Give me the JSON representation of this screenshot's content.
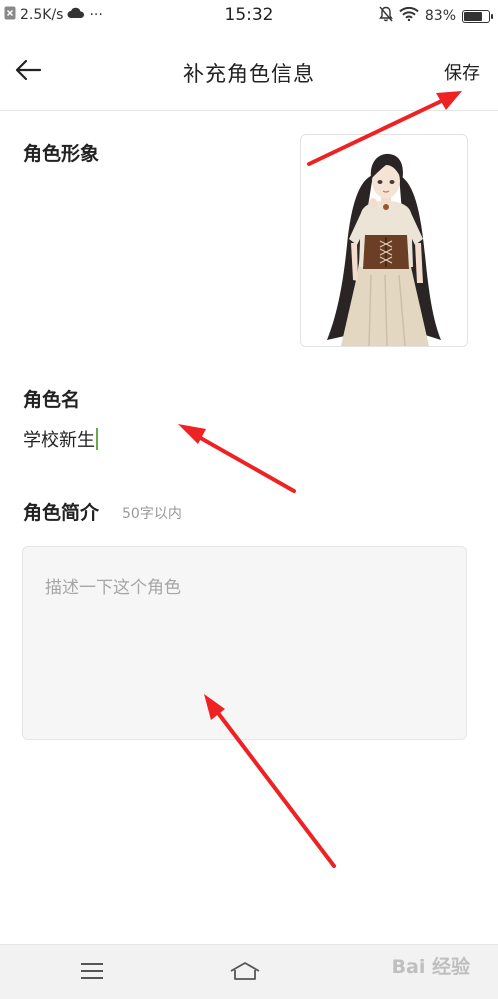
{
  "status_bar": {
    "speed": "2.5K/s",
    "dots": "···",
    "time": "15:32",
    "battery_text": "83%",
    "battery_level": 0.83
  },
  "header": {
    "title": "补充角色信息",
    "save_label": "保存",
    "back_icon": "arrow-left-icon"
  },
  "form": {
    "image_label": "角色形象",
    "name_label": "角色名",
    "name_value": "学校新生",
    "intro_label": "角色简介",
    "intro_hint": "50字以内",
    "intro_placeholder": "描述一下这个角色"
  },
  "nav": {
    "menu_icon": "menu-icon",
    "home_icon": "home-icon"
  },
  "watermark": "Bai 经验",
  "colors": {
    "caret": "#6aa84f",
    "annotation_arrow": "#ee2222",
    "textbox_bg": "#f6f6f6"
  }
}
